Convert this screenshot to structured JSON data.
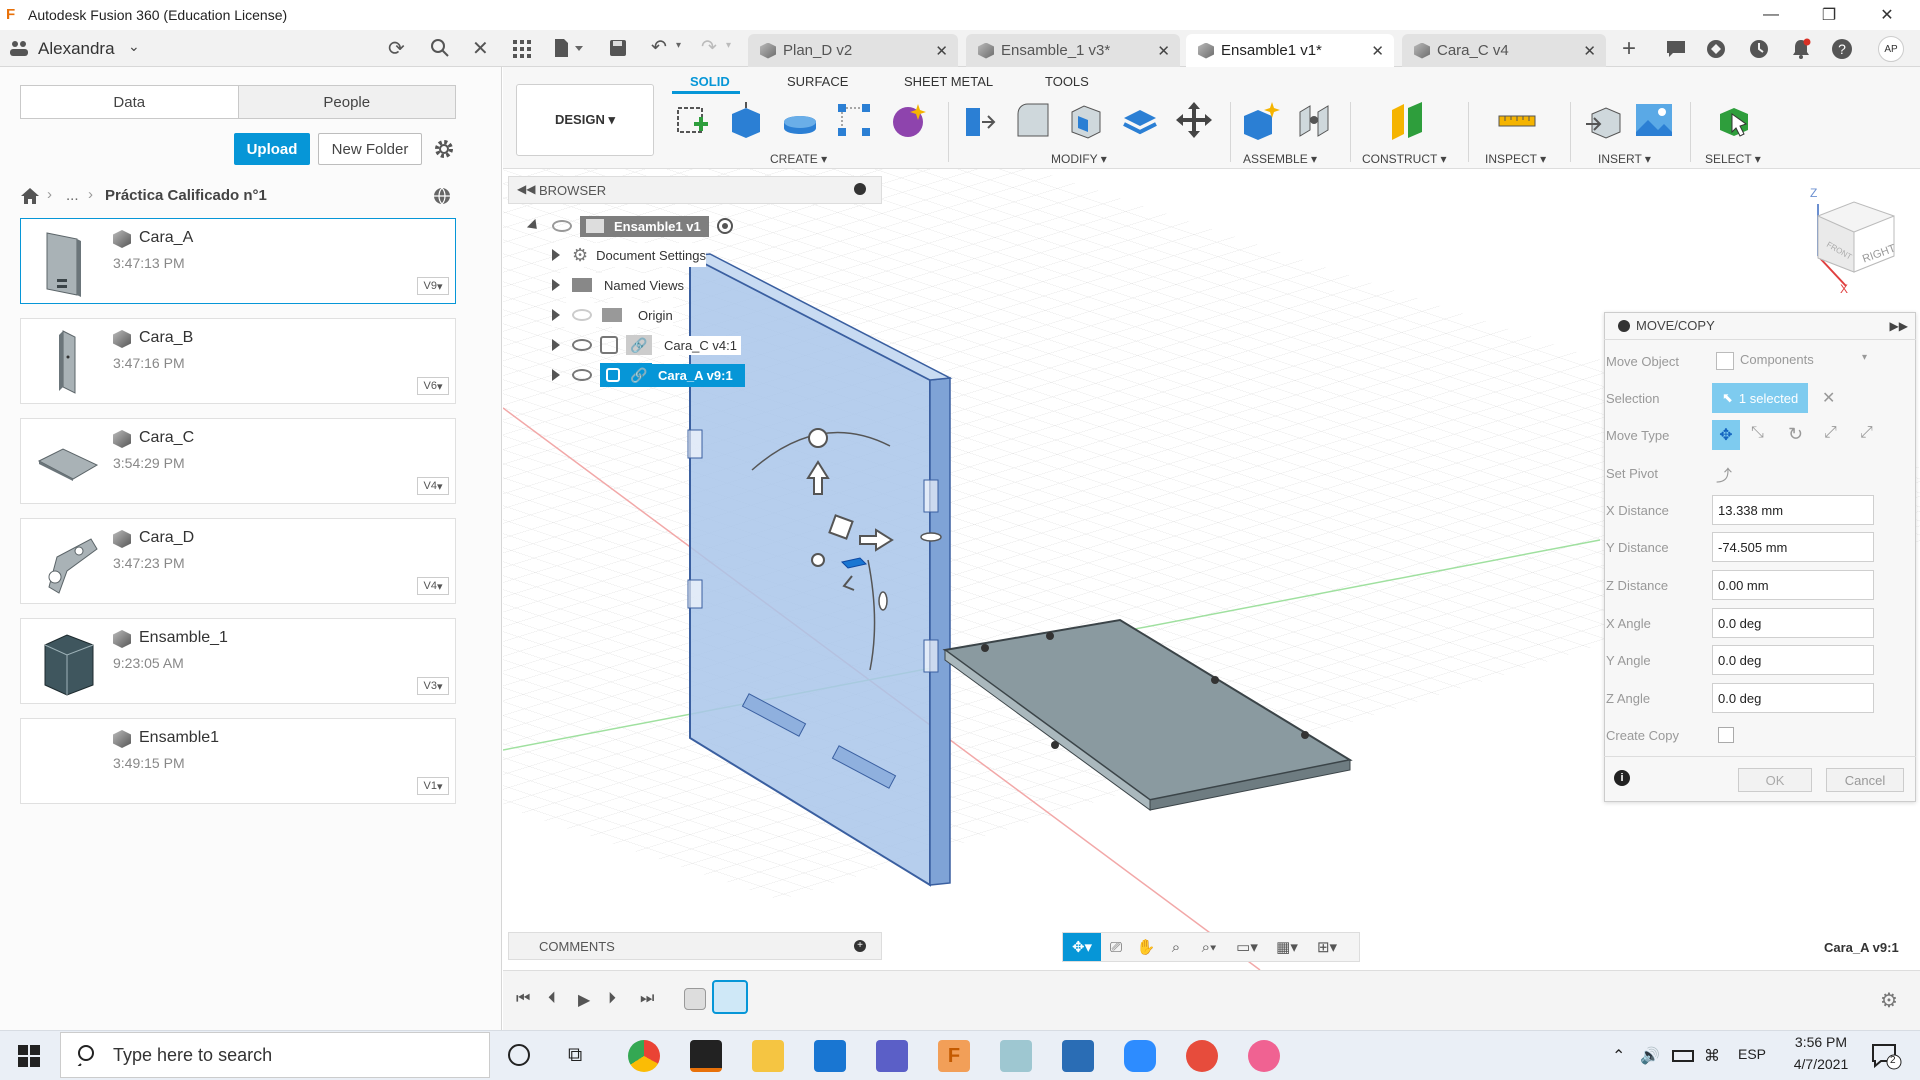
{
  "window": {
    "title": "Autodesk Fusion 360 (Education License)",
    "icon_letter": "F",
    "controls": [
      "—",
      "❐",
      "✕"
    ]
  },
  "user": {
    "name": "Alexandra",
    "initials": "AP"
  },
  "tabs": [
    {
      "label": "Plan_D v2",
      "active": false
    },
    {
      "label": "Ensamble_1 v3*",
      "active": false
    },
    {
      "label": "Ensamble1 v1*",
      "active": true
    },
    {
      "label": "Cara_C v4",
      "active": false
    }
  ],
  "data_panel": {
    "tabs": [
      "Data",
      "People"
    ],
    "upload": "Upload",
    "new_folder": "New Folder",
    "breadcrumb": {
      "ellipsis": "...",
      "current": "Práctica Calificado n°1"
    },
    "items": [
      {
        "name": "Cara_A",
        "time": "3:47:13 PM",
        "version": "V9",
        "selected": true
      },
      {
        "name": "Cara_B",
        "time": "3:47:16 PM",
        "version": "V6",
        "selected": false
      },
      {
        "name": "Cara_C",
        "time": "3:54:29 PM",
        "version": "V4",
        "selected": false
      },
      {
        "name": "Cara_D",
        "time": "3:47:23 PM",
        "version": "V4",
        "selected": false
      },
      {
        "name": "Ensamble_1",
        "time": "9:23:05 AM",
        "version": "V3",
        "selected": false
      },
      {
        "name": "Ensamble1",
        "time": "3:49:15 PM",
        "version": "V1",
        "selected": false
      }
    ]
  },
  "ribbon": {
    "workspace": "DESIGN ▾",
    "tabs": [
      "SOLID",
      "SURFACE",
      "SHEET METAL",
      "TOOLS"
    ],
    "groups": [
      "CREATE ▾",
      "MODIFY ▾",
      "ASSEMBLE ▾",
      "CONSTRUCT ▾",
      "INSPECT ▾",
      "INSERT ▾",
      "SELECT ▾"
    ]
  },
  "browser": {
    "title": "BROWSER",
    "root": "Ensamble1 v1",
    "items": [
      "Document Settings",
      "Named Views",
      "Origin",
      "Cara_C v4:1",
      "Cara_A v9:1"
    ]
  },
  "move_copy": {
    "title": "MOVE/COPY",
    "rows": {
      "move_object": {
        "label": "Move Object",
        "value": "Components"
      },
      "selection": {
        "label": "Selection",
        "value": "1 selected"
      },
      "move_type": {
        "label": "Move Type"
      },
      "set_pivot": {
        "label": "Set Pivot"
      },
      "x_distance": {
        "label": "X Distance",
        "value": "13.338 mm"
      },
      "y_distance": {
        "label": "Y Distance",
        "value": "-74.505 mm"
      },
      "z_distance": {
        "label": "Z Distance",
        "value": "0.00 mm"
      },
      "x_angle": {
        "label": "X Angle",
        "value": "0.0 deg"
      },
      "y_angle": {
        "label": "Y Angle",
        "value": "0.0 deg"
      },
      "z_angle": {
        "label": "Z Angle",
        "value": "0.0 deg"
      },
      "create_copy": {
        "label": "Create Copy"
      }
    },
    "ok": "OK",
    "cancel": "Cancel"
  },
  "viewcube": {
    "face": "RIGHT",
    "axis_z": "Z",
    "axis_x": "X"
  },
  "comments": {
    "title": "COMMENTS"
  },
  "status": {
    "selection": "Cara_A v9:1"
  },
  "taskbar": {
    "search": "Type here to search",
    "lang": "ESP",
    "time": "3:56 PM",
    "date": "4/7/2021",
    "notif_count": "2"
  },
  "colors": {
    "accent": "#0696d7",
    "selected_body": "#a9c6ea",
    "plate": "#8a9aa0"
  }
}
